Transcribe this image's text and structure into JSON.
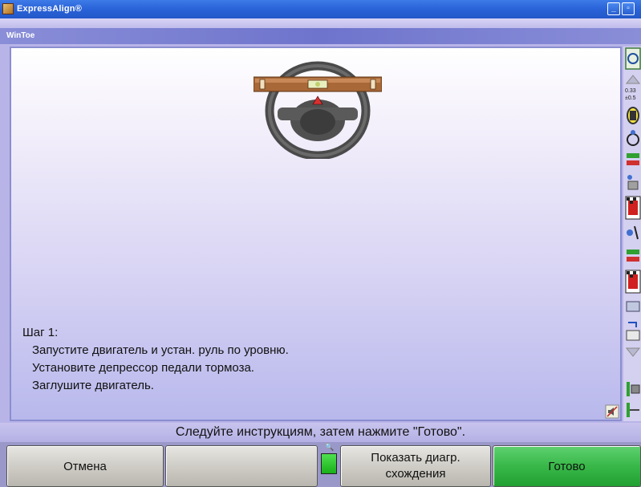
{
  "window": {
    "title": "ExpressAlign®",
    "subtitle": "WinToe"
  },
  "instructions": {
    "step_title": "Шаг 1:",
    "lines": [
      "Запустите двигатель и устан. руль по уровню.",
      "Установите депрессор педали тормоза.",
      "Заглушите двигатель."
    ]
  },
  "hint": "Следуйте инструкциям, затем нажмите \"Готово\".",
  "buttons": {
    "cancel": "Отмена",
    "blank": "",
    "diagram_line1": "Показать диагр.",
    "diagram_line2": "схождения",
    "done": "Готово"
  },
  "sidebar": {
    "reading_1": "0.33",
    "reading_2": "±0.5"
  },
  "colors": {
    "title_bar": "#2a62d8",
    "done_button": "#38b848",
    "panel_bg": "#d8d4f4"
  }
}
